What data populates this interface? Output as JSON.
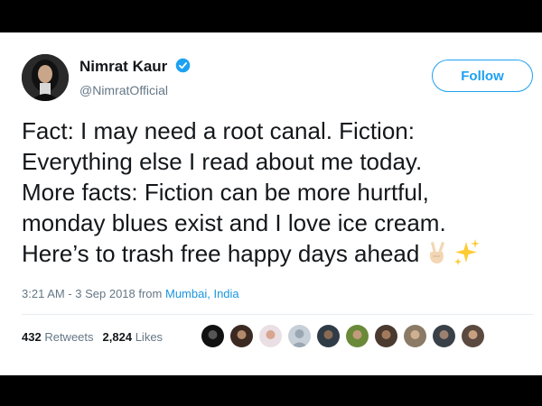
{
  "tweet": {
    "author_name": "Nimrat Kaur",
    "author_handle": "@NimratOfficial",
    "follow_label": "Follow",
    "text_lines": [
      "Fact: I may need a root canal. Fiction:",
      "Everything else I read about me today.",
      "More facts: Fiction can be more hurtful,",
      "monday blues exist and I love ice cream.",
      "Here’s to trash free happy days ahead"
    ],
    "emojis": [
      "victory-hand-emoji",
      "sparkles-emoji"
    ],
    "timestamp": "3:21 AM - 3 Sep 2018 from",
    "location": "Mumbai, India",
    "retweets_count": "432",
    "retweets_label": "Retweets",
    "likes_count": "2,824",
    "likes_label": "Likes"
  },
  "colors": {
    "accent": "#1da1f2",
    "link": "#1b95e0",
    "text": "#14171a",
    "muted": "#657786"
  },
  "icons": [
    "verified-badge-icon"
  ]
}
